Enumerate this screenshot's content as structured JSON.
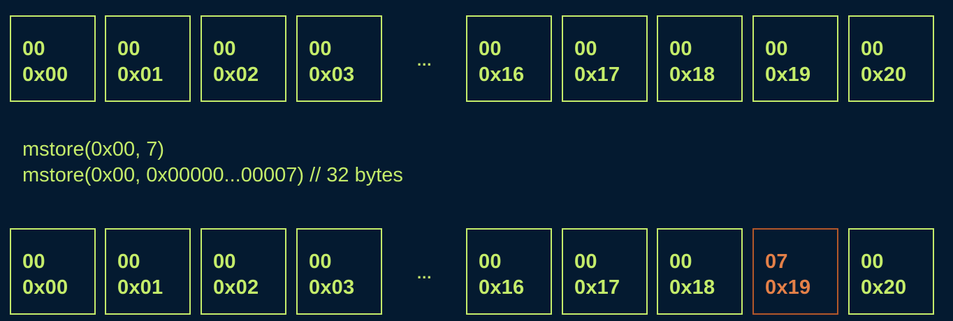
{
  "colors": {
    "background": "#041a30",
    "cell": "#c4ec6a",
    "highlight_border": "#b2572a",
    "highlight_text": "#e48048"
  },
  "before_row": {
    "cells": [
      {
        "value": "00",
        "address": "0x00"
      },
      {
        "value": "00",
        "address": "0x01"
      },
      {
        "value": "00",
        "address": "0x02"
      },
      {
        "value": "00",
        "address": "0x03"
      },
      {
        "value": "00",
        "address": "0x16"
      },
      {
        "value": "00",
        "address": "0x17"
      },
      {
        "value": "00",
        "address": "0x18"
      },
      {
        "value": "00",
        "address": "0x19"
      },
      {
        "value": "00",
        "address": "0x20"
      }
    ],
    "ellipsis": "..."
  },
  "code": {
    "line1": "mstore(0x00, 7)",
    "line2": "mstore(0x00, 0x00000...00007) // 32 bytes"
  },
  "after_row": {
    "cells": [
      {
        "value": "00",
        "address": "0x00"
      },
      {
        "value": "00",
        "address": "0x01"
      },
      {
        "value": "00",
        "address": "0x02"
      },
      {
        "value": "00",
        "address": "0x03"
      },
      {
        "value": "00",
        "address": "0x16"
      },
      {
        "value": "00",
        "address": "0x17"
      },
      {
        "value": "00",
        "address": "0x18"
      },
      {
        "value": "07",
        "address": "0x19",
        "highlighted": true
      },
      {
        "value": "00",
        "address": "0x20"
      }
    ],
    "ellipsis": "..."
  }
}
